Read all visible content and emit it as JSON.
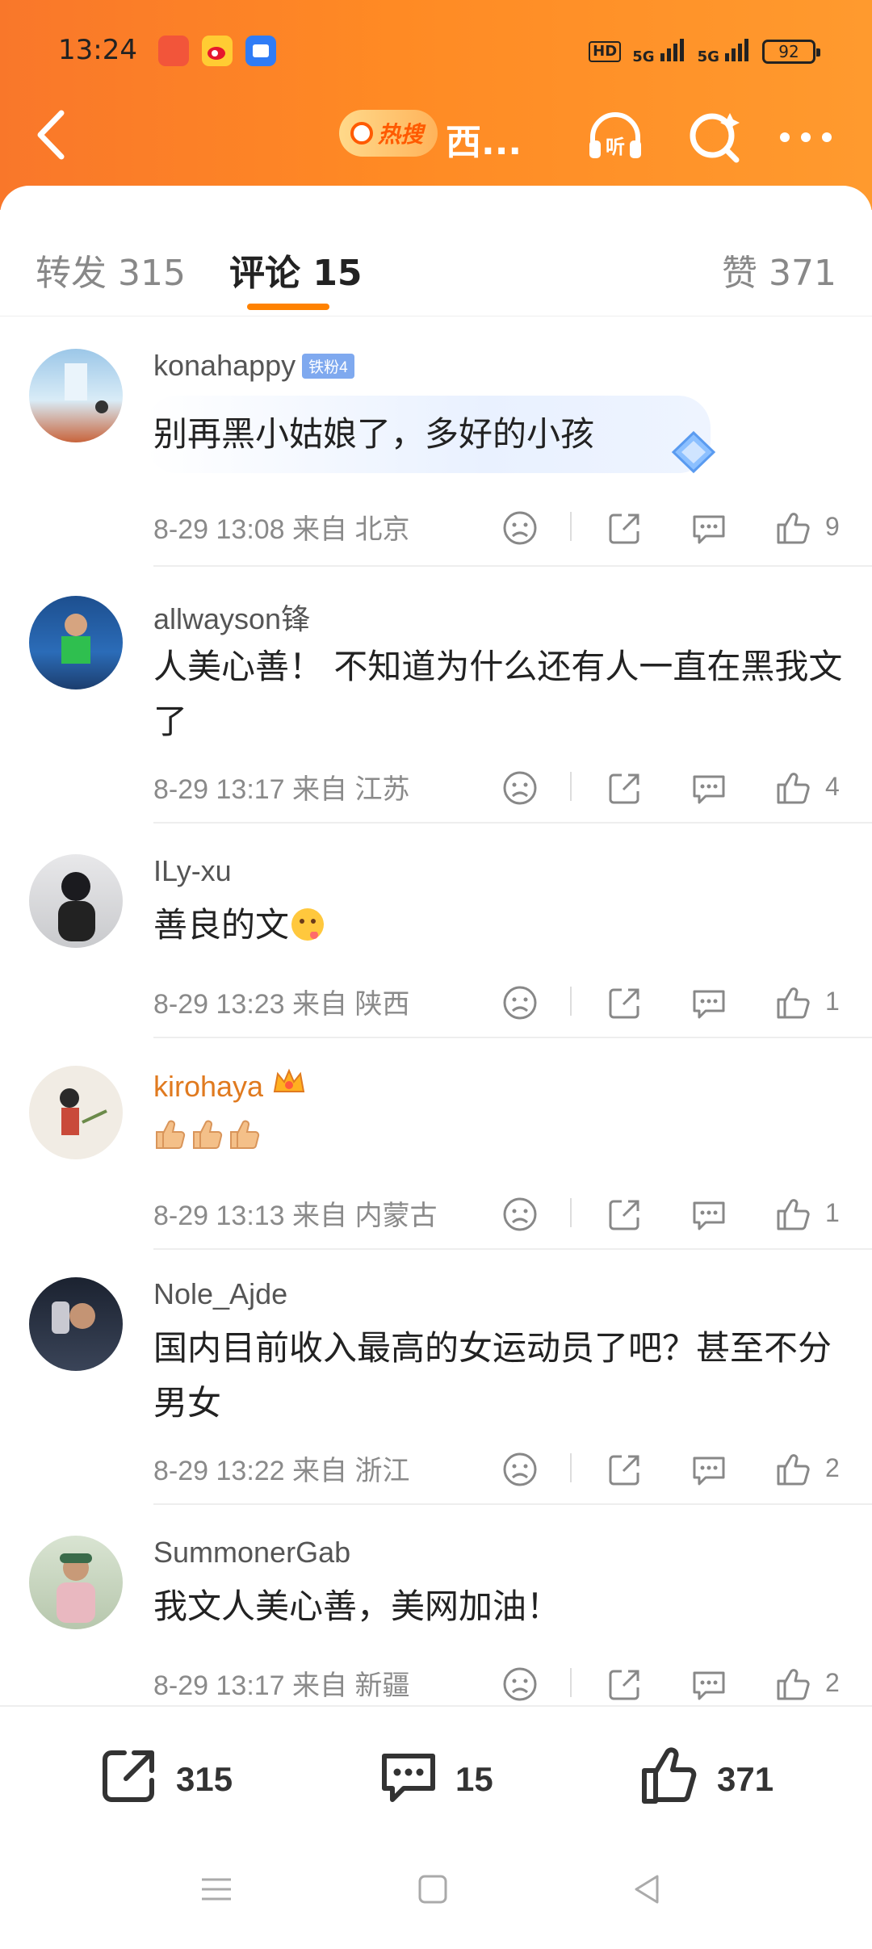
{
  "status_bar": {
    "time": "13:24",
    "battery": "92",
    "network_1": "5G",
    "network_2": "5G",
    "hd_label": "HD"
  },
  "nav": {
    "hot_search_label": "热搜",
    "title": "西..."
  },
  "tabs": {
    "repost": "转发 315",
    "comments": "评论 15",
    "likes": "赞 371"
  },
  "comments": [
    {
      "username": "konahappy",
      "badge": "铁粉4",
      "text": "别再黑小姑娘了，多好的小孩",
      "time": "8-29 13:08",
      "location": "来自 北京",
      "likes": "9"
    },
    {
      "username": "allwayson锋",
      "text": "人美心善！ 不知道为什么还有人一直在黑我文了",
      "time": "8-29 13:17",
      "location": "来自 江苏",
      "likes": "4"
    },
    {
      "username": "ILy-xu",
      "text": "善良的文",
      "time": "8-29 13:23",
      "location": "来自 陕西",
      "likes": "1"
    },
    {
      "username": "kirohaya",
      "text": "",
      "time": "8-29 13:13",
      "location": "来自 内蒙古",
      "likes": "1"
    },
    {
      "username": "Nole_Ajde",
      "text": "国内目前收入最高的女运动员了吧？甚至不分男女",
      "time": "8-29 13:22",
      "location": "来自 浙江",
      "likes": "2"
    },
    {
      "username": "SummonerGab",
      "text": "我文人美心善，美网加油！",
      "time": "8-29 13:17",
      "location": "来自 新疆",
      "likes": "2"
    }
  ],
  "bottom_bar": {
    "repost_count": "315",
    "comment_count": "15",
    "like_count": "371"
  },
  "colors": {
    "header_orange": "#ff8a24",
    "accent": "#ff8200",
    "vip_name": "#e07a1f",
    "badge_blue": "#7fa9ef"
  },
  "icons": [
    "back-arrow-icon",
    "search-magnifier-icon",
    "headphones-listen-icon",
    "search-sparkle-icon",
    "more-dots-icon",
    "dislike-face-icon",
    "share-icon",
    "comment-bubble-icon",
    "thumbs-up-icon",
    "crown-icon",
    "diamond-icon",
    "menu-icon",
    "home-square-icon",
    "back-triangle-icon"
  ]
}
